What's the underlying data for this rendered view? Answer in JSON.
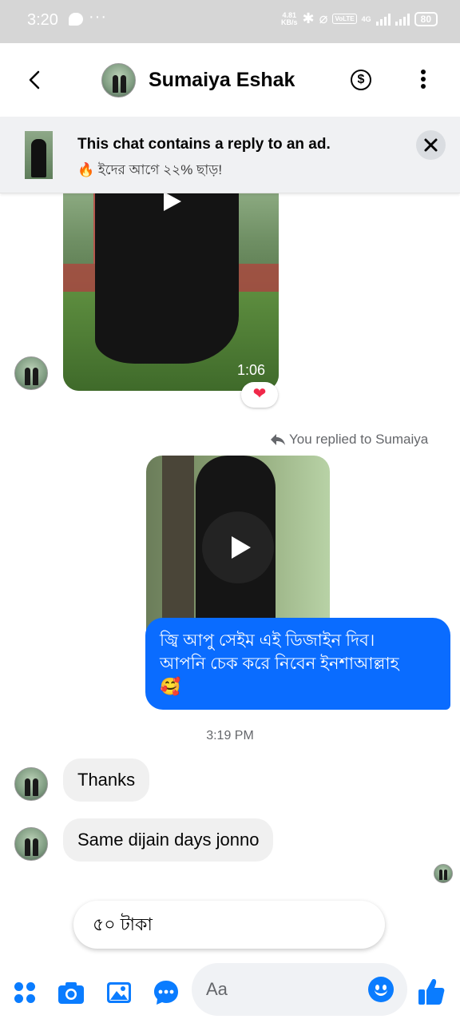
{
  "status_bar": {
    "time": "3:20",
    "speed_value": "4.81",
    "speed_unit": "KB/s",
    "volte": "VoLTE",
    "network": "4G",
    "battery": "80"
  },
  "header": {
    "contact_name": "Sumaiya Eshak"
  },
  "ad_banner": {
    "title": "This chat contains a reply to an ad.",
    "subtitle": "🔥 ইদের আগে ২২% ছাড়!"
  },
  "messages": {
    "video_duration": "1:06",
    "reaction": "❤",
    "replied_label": "You replied to Sumaiya",
    "outgoing_text_line1": "জ্বি আপু সেইম এই ডিজাইন দিব।",
    "outgoing_text_line2": "আপনি চেক করে নিবেন ইনশাআল্লাহ",
    "outgoing_emoji": "🥰",
    "timestamp": "3:19 PM",
    "incoming_1": "Thanks",
    "incoming_2": "Same dijain days jonno"
  },
  "quick_reply": {
    "text": "৫০ টাকা"
  },
  "composer": {
    "placeholder": "Aa"
  },
  "colors": {
    "accent": "#0a7cff",
    "outgoing_bubble": "#0a6cff",
    "incoming_bubble": "#f0f0f0",
    "status_bar": "#d6d6d6"
  },
  "icons": [
    "back-arrow-icon",
    "dollar-icon",
    "more-vertical-icon",
    "close-icon",
    "play-icon",
    "heart-icon",
    "reply-icon",
    "apps-icon",
    "camera-icon",
    "image-icon",
    "chat-bubble-icon",
    "emoji-icon",
    "like-icon"
  ]
}
